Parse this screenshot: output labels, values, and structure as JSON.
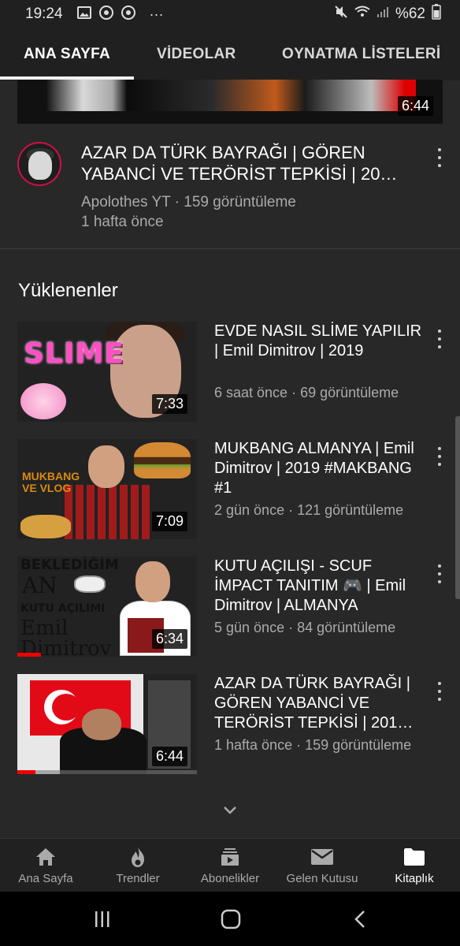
{
  "status_bar": {
    "time": "19:24",
    "more": "···",
    "battery": "%62"
  },
  "tabs": [
    {
      "label": "ANA SAYFA",
      "active": true
    },
    {
      "label": "VİDEOLAR",
      "active": false
    },
    {
      "label": "OYNATMA LİSTELERİ",
      "active": false
    }
  ],
  "top_video": {
    "duration": "6:44"
  },
  "featured": {
    "title": "AZAR DA TÜRK BAYRAĞI | GÖREN YABANCİ VE TERÖRİST TEPKİSİ | 20…",
    "channel_views": "Apolothes YT · 159 görüntüleme",
    "age": "1 hafta önce"
  },
  "section": {
    "title": "Yüklenenler"
  },
  "videos": [
    {
      "title": "EVDE NASIL SLİME YAPILIR | Emil Dimitrov | 2019",
      "meta": "6 saat önce · 69 görüntüleme",
      "duration": "7:33",
      "thumb_text": "SLIME"
    },
    {
      "title": "MUKBANG ALMANYA | Emil Dimitrov | 2019 #MAKBANG #1",
      "meta": "2 gün önce · 121 görüntüleme",
      "duration": "7:09",
      "thumb_text": "MUKBANG\nVE VLOG"
    },
    {
      "title": "KUTU AÇILIŞI - SCUF İMPACT TANITIM 🎮 | Emil Dimitrov | ALMANYA",
      "meta": "5 gün önce · 84 görüntüleme",
      "duration": "6:34",
      "thumb_text_1": "BEKLEDİĞİM",
      "thumb_text_2": "AN",
      "thumb_text_3": "KUTU AÇILIMI",
      "thumb_text_4": "Emil\nDimitrov",
      "progress": 0.13
    },
    {
      "title": "AZAR DA TÜRK BAYRAĞI | GÖREN YABANCİ VE TERÖRİST TEPKİSİ | 201…",
      "meta": "1 hafta önce · 159 görüntüleme",
      "duration": "6:44",
      "progress": 0.1
    }
  ],
  "bottom_nav": [
    {
      "label": "Ana Sayfa",
      "icon": "home-icon",
      "active": false
    },
    {
      "label": "Trendler",
      "icon": "flame-icon",
      "active": false
    },
    {
      "label": "Abonelikler",
      "icon": "subscriptions-icon",
      "active": false
    },
    {
      "label": "Gelen Kutusu",
      "icon": "mail-icon",
      "active": false
    },
    {
      "label": "Kitaplık",
      "icon": "folder-icon",
      "active": true
    }
  ],
  "colors": {
    "background": "#282828",
    "bar": "#202020",
    "progress": "#ee0000",
    "secondary_text": "#aaaaaa"
  }
}
